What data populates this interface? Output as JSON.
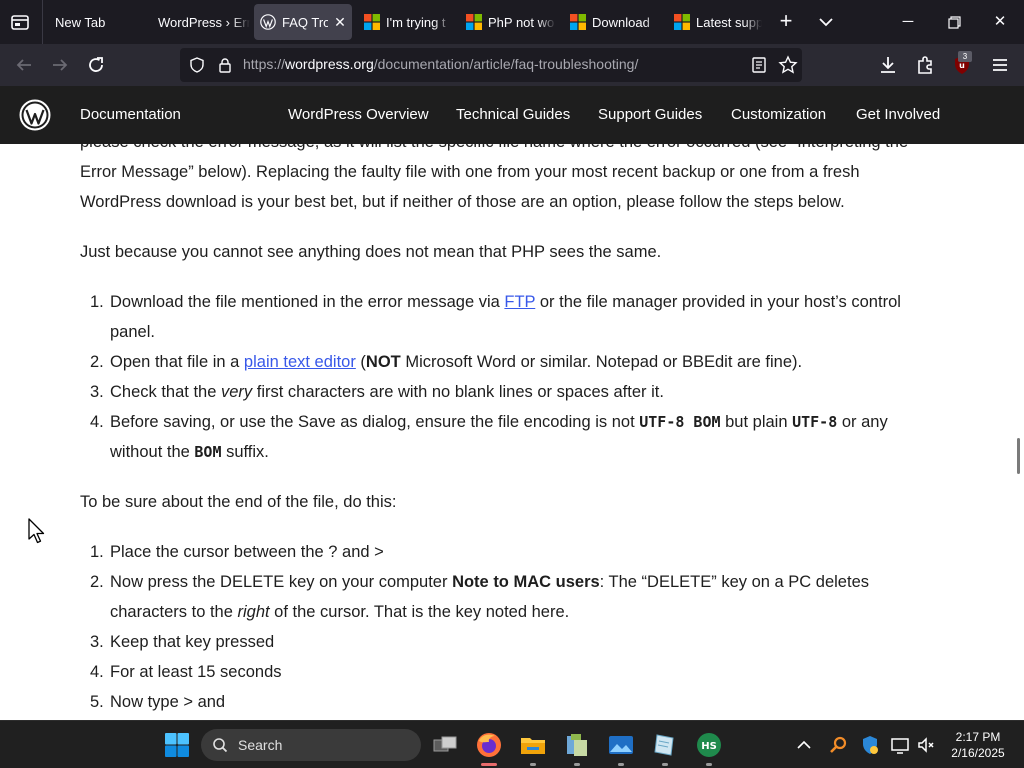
{
  "browser": {
    "tabs": [
      {
        "label": "New Tab",
        "favicon": "none"
      },
      {
        "label": "WordPress › Err",
        "favicon": "none"
      },
      {
        "label": "FAQ Trou",
        "favicon": "wordpress-icon",
        "active": true
      },
      {
        "label": "I'm trying t",
        "favicon": "microsoft-icon"
      },
      {
        "label": "PhP not wo",
        "favicon": "microsoft-icon"
      },
      {
        "label": "Download",
        "favicon": "microsoft-icon"
      },
      {
        "label": "Latest supp",
        "favicon": "microsoft-icon"
      }
    ],
    "url_prefix": "https://",
    "url_domain": "wordpress.org",
    "url_path": "/documentation/article/faq-troubleshooting/",
    "extension_badge": "3",
    "colors": {
      "tab_bar": "#1c1b22",
      "toolbar": "#2b2a33",
      "active_tab": "#42414d"
    }
  },
  "site_header": {
    "section": "Documentation",
    "nav": [
      "WordPress Overview",
      "Technical Guides",
      "Support Guides",
      "Customization",
      "Get Involved"
    ],
    "colors": {
      "background": "#1e1e1e",
      "link": "#3858e9"
    }
  },
  "content": {
    "top_partial": "please check the error message, as it will list the specific file name where the error occurred (see “Interpreting the",
    "top_line1": "Error Message” below). Replacing the faulty file with one from your most recent backup or one from a fresh",
    "top_line2": "WordPress download is your best bet, but if neither of those are an option, please follow the steps below.",
    "intro": "Just because you cannot see anything does not mean that PHP sees the same.",
    "steps1": {
      "item1_a": "Download the file mentioned in the error message via ",
      "item1_link": "FTP",
      "item1_b": " or the file manager provided in your host’s control",
      "item1_cont": "panel.",
      "item2_a": "Open that file in a ",
      "item2_link": "plain text editor",
      "item2_b": " (",
      "item2_bold": "NOT",
      "item2_c": " Microsoft Word or similar. Notepad or BBEdit are fine).",
      "item3_a": "Check that the ",
      "item3_em": "very",
      "item3_b": " first characters are with no blank lines or spaces after it.",
      "item4_a": "Before saving, or use the Save as dialog, ensure the file encoding is not ",
      "item4_code1": "UTF-8 BOM",
      "item4_b": " but plain ",
      "item4_code2": "UTF-8",
      "item4_c": " or any",
      "item4_cont_a": "without the ",
      "item4_code3": "BOM",
      "item4_cont_b": " suffix."
    },
    "end_intro": "To be sure about the end of the file, do this:",
    "steps2": {
      "item1": "Place the cursor between the ? and >",
      "item2_a": "Now press the DELETE key on your computer ",
      "item2_bold": "Note to MAC users",
      "item2_b": ": The “DELETE” key on a PC deletes",
      "item2_cont_a": "characters to the ",
      "item2_em": "right",
      "item2_cont_b": " of the cursor. That is the key noted here.",
      "item3": "Keep that key pressed",
      "item4": "For at least 15 seconds",
      "item5": "Now type > and"
    }
  },
  "taskbar": {
    "search_label": "Search",
    "time": "2:17 PM",
    "date": "2/16/2025",
    "pinned": [
      "start-icon",
      "task-view-icon",
      "firefox-icon",
      "file-explorer-icon",
      "app-icon",
      "photos-icon",
      "notepad-icon",
      "hs-app-icon"
    ],
    "tray": [
      "chevron-up-icon",
      "search-tool-icon",
      "defender-icon",
      "network-icon",
      "volume-icon"
    ],
    "colors": {
      "background": "#202020"
    }
  }
}
